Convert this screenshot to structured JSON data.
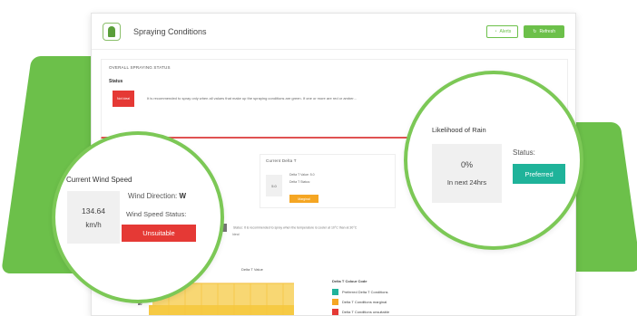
{
  "app": {
    "title": "Spraying Conditions",
    "btn_outline": "Alerts",
    "btn_solid": "Refresh"
  },
  "overall": {
    "heading": "OVERALL SPRAYING STATUS",
    "status_label": "Status",
    "status_badge": "Not Ideal",
    "status_message": "It is recommended to spray only when all values that make up the spraying conditions are green. If one or more are red or amber..."
  },
  "wind": {
    "title": "Current Wind Speed",
    "value": "134.64",
    "unit": "km/h",
    "direction_label": "Wind Direction:",
    "direction_value": "W",
    "status_label": "Wind Speed Status:",
    "status_value": "Unsuitable"
  },
  "rain": {
    "title": "Likelihood of Rain",
    "percent": "0%",
    "subtitle": "In next 24hrs",
    "status_label": "Status:",
    "status_value": "Preferred"
  },
  "delta": {
    "heading": "Current Delta T",
    "value": "5.0",
    "line1": "Delta T Value: 5.0",
    "line2": "Delta T Status:",
    "badge": "Marginal"
  },
  "temperature": {
    "box": "N/A",
    "line1": "Status: It is recommended to spray when the temperature is cooler at 10°C than at 30°C",
    "line2": "Ideal"
  },
  "chart": {
    "title": "Delta T Value",
    "ytick": "80"
  },
  "legend": {
    "title": "Delta T Colour Code",
    "items": [
      {
        "label": "Preferred Delta T Conditions",
        "color": "#1fb39a"
      },
      {
        "label": "Delta T Conditions marginal",
        "color": "#f5a623"
      },
      {
        "label": "Delta T Conditions unsuitable",
        "color": "#e53935"
      }
    ]
  },
  "colors": {
    "brand_green": "#6cc04a",
    "red": "#e53935",
    "teal": "#1fb39a",
    "amber": "#f5a623",
    "chart_fill": "#f6c944"
  }
}
